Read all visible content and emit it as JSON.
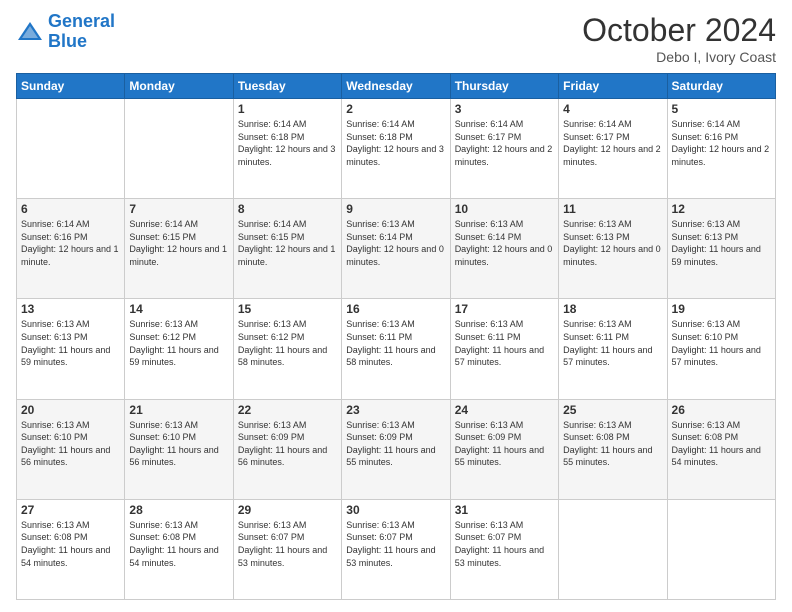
{
  "header": {
    "logo_line1": "General",
    "logo_line2": "Blue",
    "month_title": "October 2024",
    "location": "Debo I, Ivory Coast"
  },
  "days_of_week": [
    "Sunday",
    "Monday",
    "Tuesday",
    "Wednesday",
    "Thursday",
    "Friday",
    "Saturday"
  ],
  "weeks": [
    [
      {
        "day": "",
        "info": ""
      },
      {
        "day": "",
        "info": ""
      },
      {
        "day": "1",
        "info": "Sunrise: 6:14 AM\nSunset: 6:18 PM\nDaylight: 12 hours and 3 minutes."
      },
      {
        "day": "2",
        "info": "Sunrise: 6:14 AM\nSunset: 6:18 PM\nDaylight: 12 hours and 3 minutes."
      },
      {
        "day": "3",
        "info": "Sunrise: 6:14 AM\nSunset: 6:17 PM\nDaylight: 12 hours and 2 minutes."
      },
      {
        "day": "4",
        "info": "Sunrise: 6:14 AM\nSunset: 6:17 PM\nDaylight: 12 hours and 2 minutes."
      },
      {
        "day": "5",
        "info": "Sunrise: 6:14 AM\nSunset: 6:16 PM\nDaylight: 12 hours and 2 minutes."
      }
    ],
    [
      {
        "day": "6",
        "info": "Sunrise: 6:14 AM\nSunset: 6:16 PM\nDaylight: 12 hours and 1 minute."
      },
      {
        "day": "7",
        "info": "Sunrise: 6:14 AM\nSunset: 6:15 PM\nDaylight: 12 hours and 1 minute."
      },
      {
        "day": "8",
        "info": "Sunrise: 6:14 AM\nSunset: 6:15 PM\nDaylight: 12 hours and 1 minute."
      },
      {
        "day": "9",
        "info": "Sunrise: 6:13 AM\nSunset: 6:14 PM\nDaylight: 12 hours and 0 minutes."
      },
      {
        "day": "10",
        "info": "Sunrise: 6:13 AM\nSunset: 6:14 PM\nDaylight: 12 hours and 0 minutes."
      },
      {
        "day": "11",
        "info": "Sunrise: 6:13 AM\nSunset: 6:13 PM\nDaylight: 12 hours and 0 minutes."
      },
      {
        "day": "12",
        "info": "Sunrise: 6:13 AM\nSunset: 6:13 PM\nDaylight: 11 hours and 59 minutes."
      }
    ],
    [
      {
        "day": "13",
        "info": "Sunrise: 6:13 AM\nSunset: 6:13 PM\nDaylight: 11 hours and 59 minutes."
      },
      {
        "day": "14",
        "info": "Sunrise: 6:13 AM\nSunset: 6:12 PM\nDaylight: 11 hours and 59 minutes."
      },
      {
        "day": "15",
        "info": "Sunrise: 6:13 AM\nSunset: 6:12 PM\nDaylight: 11 hours and 58 minutes."
      },
      {
        "day": "16",
        "info": "Sunrise: 6:13 AM\nSunset: 6:11 PM\nDaylight: 11 hours and 58 minutes."
      },
      {
        "day": "17",
        "info": "Sunrise: 6:13 AM\nSunset: 6:11 PM\nDaylight: 11 hours and 57 minutes."
      },
      {
        "day": "18",
        "info": "Sunrise: 6:13 AM\nSunset: 6:11 PM\nDaylight: 11 hours and 57 minutes."
      },
      {
        "day": "19",
        "info": "Sunrise: 6:13 AM\nSunset: 6:10 PM\nDaylight: 11 hours and 57 minutes."
      }
    ],
    [
      {
        "day": "20",
        "info": "Sunrise: 6:13 AM\nSunset: 6:10 PM\nDaylight: 11 hours and 56 minutes."
      },
      {
        "day": "21",
        "info": "Sunrise: 6:13 AM\nSunset: 6:10 PM\nDaylight: 11 hours and 56 minutes."
      },
      {
        "day": "22",
        "info": "Sunrise: 6:13 AM\nSunset: 6:09 PM\nDaylight: 11 hours and 56 minutes."
      },
      {
        "day": "23",
        "info": "Sunrise: 6:13 AM\nSunset: 6:09 PM\nDaylight: 11 hours and 55 minutes."
      },
      {
        "day": "24",
        "info": "Sunrise: 6:13 AM\nSunset: 6:09 PM\nDaylight: 11 hours and 55 minutes."
      },
      {
        "day": "25",
        "info": "Sunrise: 6:13 AM\nSunset: 6:08 PM\nDaylight: 11 hours and 55 minutes."
      },
      {
        "day": "26",
        "info": "Sunrise: 6:13 AM\nSunset: 6:08 PM\nDaylight: 11 hours and 54 minutes."
      }
    ],
    [
      {
        "day": "27",
        "info": "Sunrise: 6:13 AM\nSunset: 6:08 PM\nDaylight: 11 hours and 54 minutes."
      },
      {
        "day": "28",
        "info": "Sunrise: 6:13 AM\nSunset: 6:08 PM\nDaylight: 11 hours and 54 minutes."
      },
      {
        "day": "29",
        "info": "Sunrise: 6:13 AM\nSunset: 6:07 PM\nDaylight: 11 hours and 53 minutes."
      },
      {
        "day": "30",
        "info": "Sunrise: 6:13 AM\nSunset: 6:07 PM\nDaylight: 11 hours and 53 minutes."
      },
      {
        "day": "31",
        "info": "Sunrise: 6:13 AM\nSunset: 6:07 PM\nDaylight: 11 hours and 53 minutes."
      },
      {
        "day": "",
        "info": ""
      },
      {
        "day": "",
        "info": ""
      }
    ]
  ]
}
